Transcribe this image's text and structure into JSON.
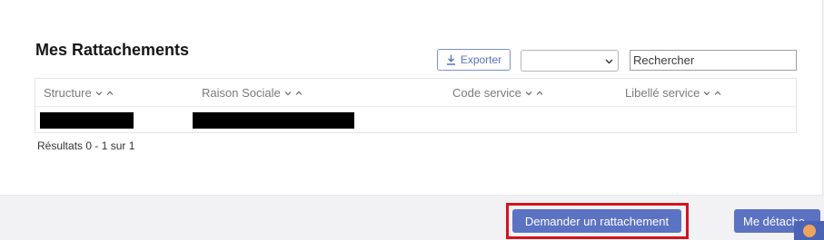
{
  "section": {
    "title": "Mes Rattachements"
  },
  "toolbar": {
    "export_label": "Exporter",
    "filter_select_value": "",
    "search_placeholder": "Rechercher"
  },
  "table": {
    "columns": [
      "Structure",
      "Raison Sociale",
      "Code service",
      "Libellé service"
    ],
    "rows": [
      {
        "structure": "[redacted]",
        "raison_sociale": "[redacted]",
        "code_service": "",
        "libelle_service": ""
      }
    ]
  },
  "pagination": {
    "results_text": "Résultats 0 - 1 sur 1"
  },
  "actions": {
    "request_label": "Demander un rattachement",
    "detach_label": "Me détache"
  },
  "colors": {
    "primary": "#5c72c2",
    "highlight": "#d3141c"
  }
}
